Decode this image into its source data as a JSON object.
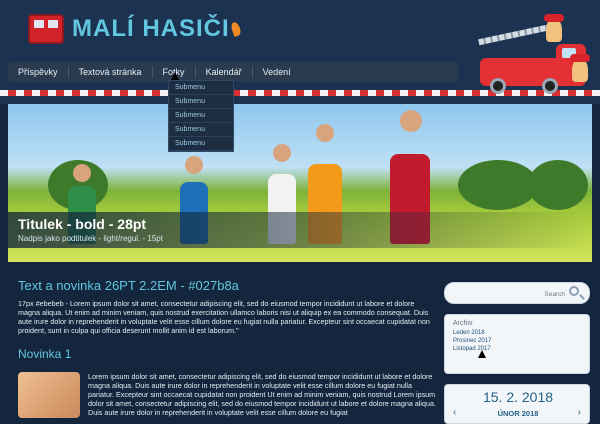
{
  "header": {
    "title": "MALÍ HASIČI",
    "nav": [
      "Příspěvky",
      "Textová stránka",
      "Fotky",
      "Kalendář",
      "Vedení"
    ],
    "submenu": [
      "Submenu",
      "Submenu",
      "Submenu",
      "Submenu",
      "Submenu"
    ]
  },
  "hero": {
    "title": "Titulek - bold - 28pt",
    "subtitle": "Nadpis jako podtitulek - light/regul. - 15pt"
  },
  "main": {
    "heading": "Text a novinka 26PT 2.2EM - #027b8a",
    "intro": "17px #ebebeb - Lorem ipsum dolor sit amet, consectetur adipiscing elit, sed do eiusmod tempor incididunt ut labore et dolore magna aliqua. Ut enim ad minim veniam, quis nostrud exercitation ullamco laboris nisi ut aliquip ex ea commodo consequat. Duis aute irure dolor in reprehenderit in voluptate velit esse cillum dolore eu fugiat nulla pariatur. Excepteur sint occaecat cupidatat non proident, sunt in culpa qui officia deserunt mollit anim id est laborum.\"",
    "news_title": "Novinka 1",
    "news_text": "Lorem ipsum dolor sit amet, consectetur adipiscing elit, sed do eiusmod tempor incididunt ut labore et dolore magna aliqua. Duis aute irure dolor in reprehenderit in voluptate velit esse cillum dolore eu fugiat nulla pariatur. Excepteur sint occaecat cupidatat non proident Ut enim ad minim veniam, quis nostrud Lorem ipsum dolor sit amet, consectetur adipiscing elit, sed do eiusmod tempor incididunt ut labore et dolore magna aliqua. Duis aute irure dolor in reprehenderit in voluptate velit esse cillum dolore eu fugiat"
  },
  "sidebar": {
    "search_placeholder": "Search",
    "archive_title": "Archiv",
    "archive_items": [
      "Leden 2018",
      "Prosinec 2017",
      "Listopad 2017"
    ],
    "calendar_date": "15. 2. 2018",
    "calendar_month": "ÚNOR 2018"
  },
  "colors": {
    "accent": "#63c6df",
    "background": "#13263d",
    "nav": "#2a3b4f"
  }
}
